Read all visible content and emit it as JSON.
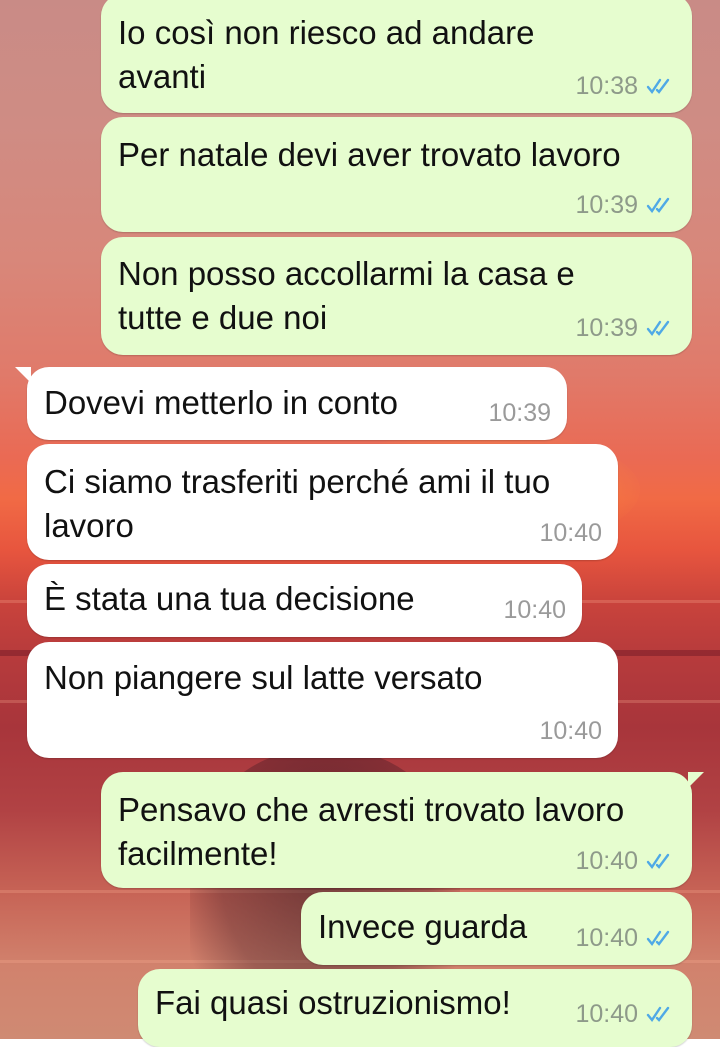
{
  "messages": [
    {
      "direction": "out",
      "text": "Io così non riesco ad andare avanti",
      "time": "10:38",
      "read": true
    },
    {
      "direction": "out",
      "text": "Per natale devi aver trovato lavoro",
      "time": "10:39",
      "read": true
    },
    {
      "direction": "out",
      "text": "Non posso accollarmi la casa e tutte e due noi",
      "time": "10:39",
      "read": true
    },
    {
      "direction": "in",
      "text": "Dovevi metterlo in conto",
      "time": "10:39"
    },
    {
      "direction": "in",
      "text": "Ci siamo trasferiti perché ami il tuo lavoro",
      "time": "10:40"
    },
    {
      "direction": "in",
      "text": "È stata una tua decisione",
      "time": "10:40"
    },
    {
      "direction": "in",
      "text": "Non piangere sul latte versato",
      "time": "10:40"
    },
    {
      "direction": "out",
      "text": "Pensavo che avresti trovato lavoro facilmente!",
      "time": "10:40",
      "read": true
    },
    {
      "direction": "out",
      "text": "Invece guarda",
      "time": "10:40",
      "read": true
    },
    {
      "direction": "out",
      "text": "Fai quasi ostruzionismo!",
      "time": "10:40",
      "read": true
    }
  ],
  "colors": {
    "outgoing_bubble": "#e6fdcf",
    "incoming_bubble": "#ffffff",
    "read_ticks": "#4fa9e6"
  },
  "icons": {
    "read_receipt": "double-check-icon"
  }
}
